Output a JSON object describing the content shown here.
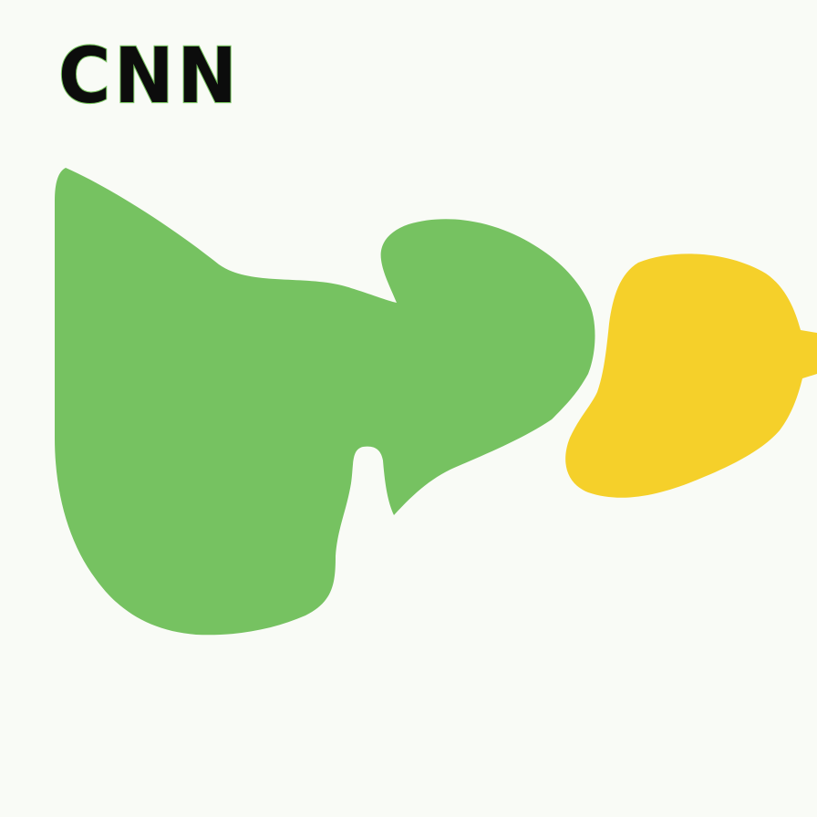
{
  "title": "CNN",
  "colors": {
    "background": "#f9fbf6",
    "title_text": "#0c0c0c",
    "title_outline": "#78c45f",
    "green_shape": "#76c261",
    "yellow_shape": "#f5d02a"
  }
}
